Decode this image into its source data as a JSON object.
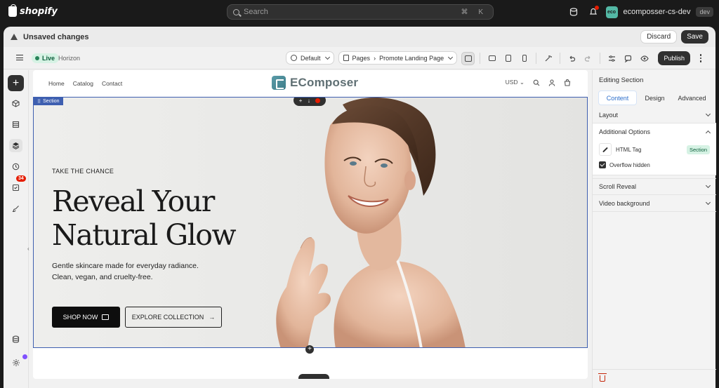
{
  "topbar": {
    "logo_text": "shopify",
    "search_placeholder": "Search",
    "search_shortcut": "⌘ K",
    "store_initials": "eco",
    "store_name": "ecomposser-cs-dev",
    "store_badge": "dev"
  },
  "unsaved": {
    "message": "Unsaved changes",
    "discard_label": "Discard",
    "save_label": "Save"
  },
  "toolbar": {
    "status": "Live",
    "theme": "Horizon",
    "locale": "Default",
    "pages_label": "Pages",
    "page_name": "Promote Landing Page",
    "publish_label": "Publish"
  },
  "rail": {
    "notification_count": "34"
  },
  "site": {
    "nav_links": [
      "Home",
      "Catalog",
      "Contact"
    ],
    "brand_name": "EComposer",
    "currency": "USD"
  },
  "hero": {
    "section_tag": "Section",
    "eyebrow": "TAKE THE CHANCE",
    "headline_line1": "Reveal Your",
    "headline_line2": "Natural Glow",
    "sub_line1": "Gentle skincare made for everyday radiance.",
    "sub_line2": "Clean, vegan, and cruelty-free.",
    "cta_primary": "SHOP NOW",
    "cta_secondary": "EXPLORE COLLECTION"
  },
  "panel": {
    "title": "Editing Section",
    "tabs": [
      "Content",
      "Design",
      "Advanced"
    ],
    "active_tab": "Content",
    "sections": {
      "layout": "Layout",
      "additional_options": "Additional Options",
      "scroll_reveal": "Scroll Reveal",
      "video_background": "Video background"
    },
    "html_tag_label": "HTML Tag",
    "html_tag_value": "Section",
    "overflow_label": "Overflow hidden",
    "overflow_checked": true
  },
  "colors": {
    "selection_blue": "#3e5fb0",
    "live_green": "#29845a",
    "danger": "#e51c00",
    "brand_teal": "#4f8e9a"
  }
}
